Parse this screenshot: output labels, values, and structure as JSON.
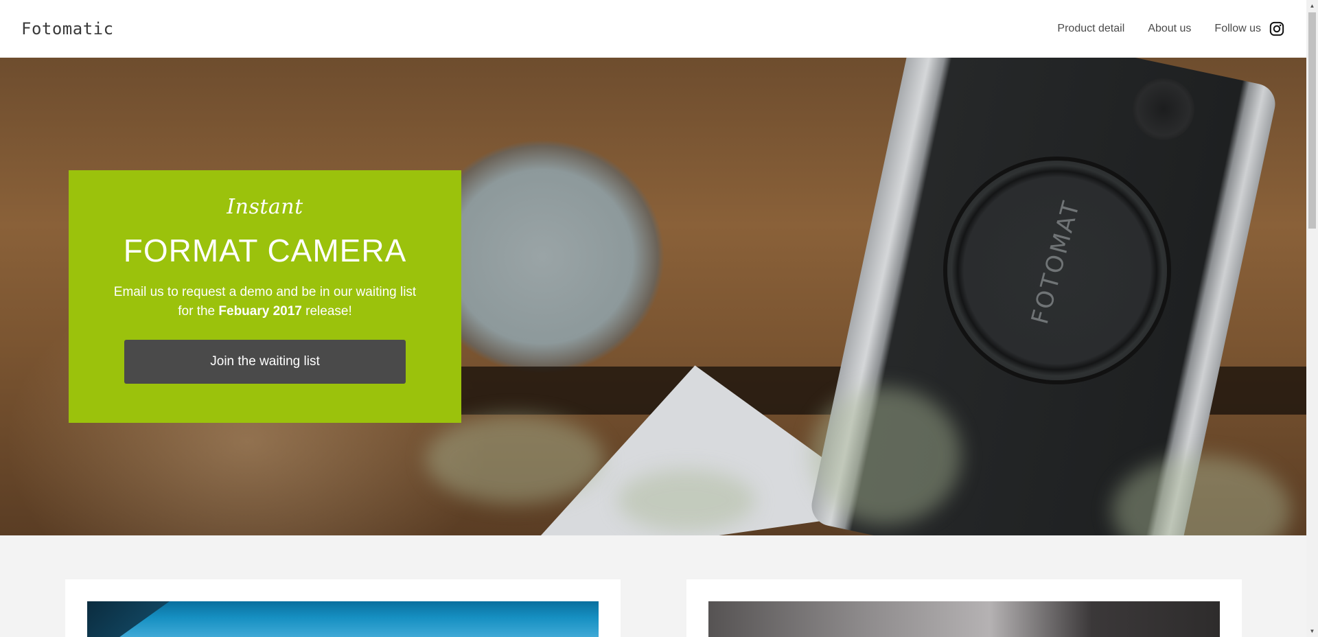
{
  "header": {
    "brand": "Fotomatic",
    "nav": [
      {
        "label": "Product detail"
      },
      {
        "label": "About us"
      }
    ],
    "follow_label": "Follow us",
    "follow_icon": "instagram-icon"
  },
  "hero": {
    "image_text": "FOTOMAT",
    "promo": {
      "kicker": "Instant",
      "title": "FORMAT CAMERA",
      "desc_part1": "Email us to request a demo and be in our waiting list for the ",
      "desc_bold": "Febuary 2017",
      "desc_part2": " release!",
      "cta_label": "Join the waiting list",
      "background": "#9bc20c",
      "cta_background": "#4a4a4a"
    }
  },
  "scrollbar": {
    "up_glyph": "▲",
    "down_glyph": "▼"
  }
}
